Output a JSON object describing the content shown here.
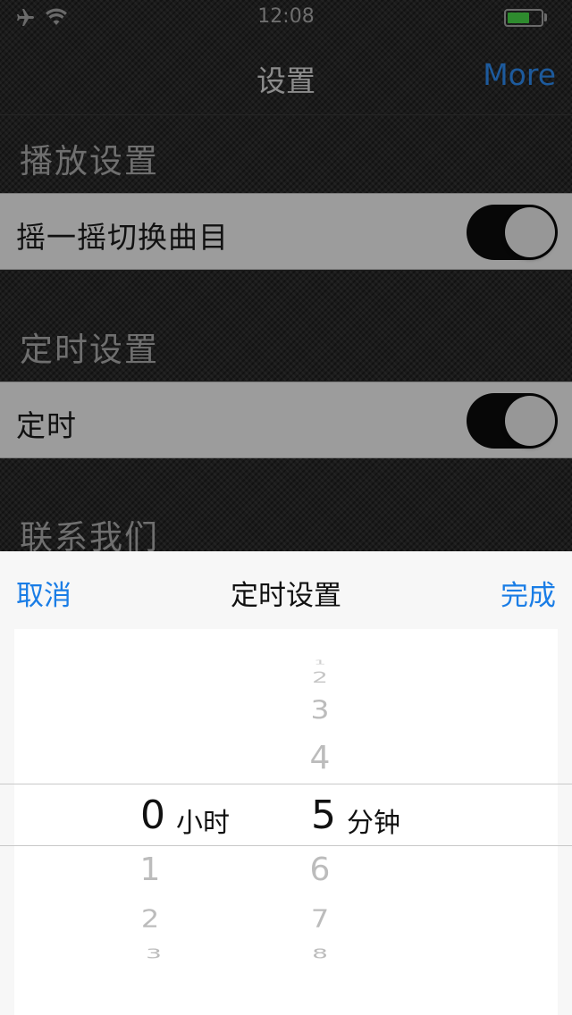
{
  "status_bar": {
    "time": "12:08",
    "icons": [
      "airplane-icon",
      "wifi-icon",
      "battery-icon"
    ]
  },
  "nav": {
    "title": "设置",
    "right_button": "More"
  },
  "sections": {
    "playback": {
      "header": "播放设置",
      "row_label": "摇一摇切换曲目",
      "switch_on": true
    },
    "timer": {
      "header": "定时设置",
      "row_label": "定时",
      "switch_on": true
    },
    "contact": {
      "header": "联系我们"
    }
  },
  "sheet": {
    "cancel": "取消",
    "title": "定时设置",
    "done": "完成"
  },
  "picker": {
    "hours": {
      "above": [],
      "selected": "0",
      "below": [
        "1",
        "2",
        "3"
      ],
      "unit": "小时"
    },
    "minutes": {
      "above": [
        "2",
        "3",
        "4"
      ],
      "selected": "5",
      "below": [
        "6",
        "7",
        "8"
      ],
      "unit": "分钟"
    }
  },
  "colors": {
    "accent": "#1a7de6",
    "nav_more": "#1d5a9c",
    "battery": "#2e8b2e"
  }
}
